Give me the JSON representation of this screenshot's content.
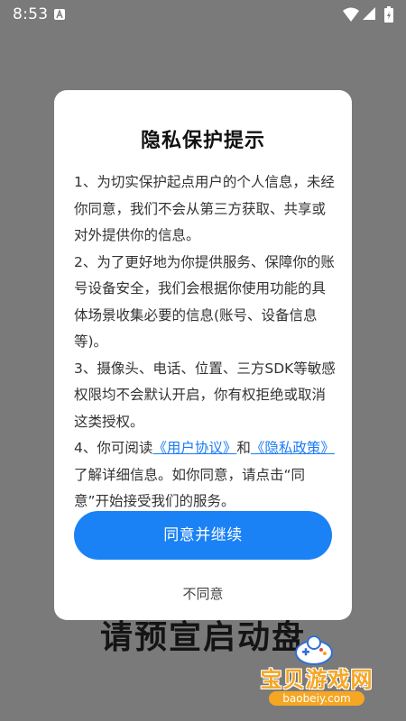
{
  "status_bar": {
    "time": "8:53"
  },
  "background_text": "请预宣启动盘",
  "dialog": {
    "title": "隐私保护提示",
    "p1": "1、为切实保护起点用户的个人信息，未经你同意，我们不会从第三方获取、共享或对外提供你的信息。",
    "p2": "2、为了更好地为你提供服务、保障你的账号设备安全，我们会根据你使用功能的具体场景收集必要的信息(账号、设备信息等)。",
    "p3": "3、摄像头、电话、位置、三方SDK等敏感权限均不会默认开启，你有权拒绝或取消这类授权。",
    "p4_prefix": "4、你可阅读",
    "link_user_agreement": "《用户协议》",
    "p4_and": "和",
    "link_privacy_policy": "《隐私政策》",
    "p4_suffix": "了解详细信息。如你同意，请点击“同意”开始接受我们的服务。",
    "agree_label": "同意并继续",
    "disagree_label": "不同意"
  },
  "watermark": {
    "name": "宝贝游戏网",
    "url": "baobeiy.com"
  },
  "colors": {
    "accent": "#1b82f5",
    "link": "#1a7cf5",
    "overlay": "#7a7a7a",
    "watermark": "#f5a623"
  }
}
